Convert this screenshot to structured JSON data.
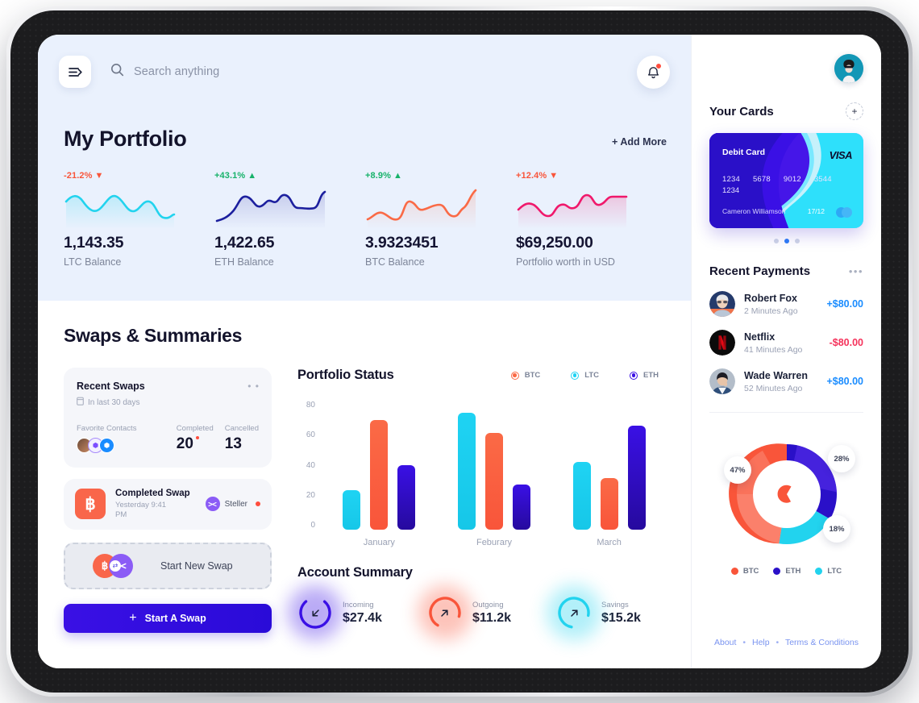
{
  "topbar": {
    "menu_icon": "menu-arrow-icon",
    "search_icon": "search-icon",
    "search_placeholder": "Search anything",
    "search_value": "",
    "bell_icon": "bell-icon",
    "avatar_icon": "user-avatar"
  },
  "portfolio": {
    "title": "My Portfolio",
    "add_more": "+ Add More",
    "stats": [
      {
        "delta": "-21.2%",
        "direction": "down",
        "value": "1,143.35",
        "label": "LTC Balance",
        "color": "#22d3ee"
      },
      {
        "delta": "+43.1%",
        "direction": "up",
        "value": "1,422.65",
        "label": "ETH Balance",
        "color": "#1c1f9e"
      },
      {
        "delta": "+8.9%",
        "direction": "up",
        "value": "3.9323451",
        "label": "BTC Balance",
        "color": "#fa6a46"
      },
      {
        "delta": "+12.4%",
        "direction": "down",
        "value": "$69,250.00",
        "label": "Portfolio worth in USD",
        "color": "#f0186b"
      }
    ]
  },
  "swaps": {
    "title": "Swaps & Summaries",
    "recent_swaps": {
      "title": "Recent Swaps",
      "calendar_icon": "calendar-icon",
      "subtitle": "In last 30 days",
      "more_icon": "more-dots-icon",
      "contacts_label": "Favorite Contacts",
      "completed_label": "Completed",
      "completed_value": "20",
      "cancelled_label": "Cancelled",
      "cancelled_value": "13"
    },
    "completed_swap": {
      "coin_icon": "bitcoin-icon",
      "title": "Completed Swap",
      "time": "Yesterday 9:41 PM",
      "partner_icon": "steller-icon",
      "partner": "Steller"
    },
    "start_new_swap": {
      "label": "Start New Swap",
      "from_icon": "bitcoin-icon",
      "to_icon": "steller-icon"
    },
    "start_a_swap_button": "Start A Swap",
    "plus_icon": "plus-icon"
  },
  "chart_data": {
    "type": "bar",
    "title": "Portfolio Status",
    "categories": [
      "January",
      "Feburary",
      "March"
    ],
    "series": [
      {
        "name": "LTC",
        "color": "#1fd3f3",
        "values": [
          27,
          80,
          46
        ]
      },
      {
        "name": "BTC",
        "color": "#fa6a46",
        "values": [
          75,
          66,
          35
        ]
      },
      {
        "name": "ETH",
        "color": "#3a10e5",
        "values": [
          44,
          31,
          71
        ]
      }
    ],
    "legend": [
      "BTC",
      "LTC",
      "ETH"
    ],
    "legend_colors": [
      "#fa6a46",
      "#1fd3f3",
      "#3a10e5"
    ],
    "legend_position": "top-right",
    "yticks": [
      "80",
      "60",
      "40",
      "20",
      "0"
    ],
    "ylim": [
      0,
      88
    ],
    "xlabel": "",
    "ylabel": "",
    "grid": false
  },
  "donut_data": {
    "type": "pie",
    "labels": [
      "BTC",
      "ETH",
      "LTC"
    ],
    "values": [
      47,
      28,
      18
    ],
    "display": [
      "47%",
      "28%",
      "18%"
    ],
    "colors": [
      "#fa6a46",
      "#2a10c8",
      "#22d3ee"
    ],
    "legend_position": "bottom"
  },
  "account_summary": {
    "title": "Account Summary",
    "items": [
      {
        "icon": "arrow-down-left-icon",
        "label": "Incoming",
        "value": "$27.4k",
        "color": "#3a10e5"
      },
      {
        "icon": "arrow-up-right-icon",
        "label": "Outgoing",
        "value": "$11.2k",
        "color": "#f9553a"
      },
      {
        "icon": "arrow-up-right-icon",
        "label": "Savings",
        "value": "$15.2k",
        "color": "#22d3ee"
      }
    ]
  },
  "sidebar": {
    "cards": {
      "title": "Your Cards",
      "add_icon": "add-card-icon",
      "card": {
        "type": "Debit Card",
        "brand": "VISA",
        "number_groups": [
          "1234",
          "5678",
          "9012",
          "3544"
        ],
        "number_overflow": "1234",
        "holder": "Cameron Williamson",
        "expiry": "17/12",
        "chip_icon": "mastercard-icon"
      },
      "pagination": {
        "count": 3,
        "active": 1
      }
    },
    "payments": {
      "title": "Recent Payments",
      "more_icon": "more-dots-icon",
      "items": [
        {
          "name": "Robert Fox",
          "time": "2 Minutes Ago",
          "amount": "+$80.00",
          "color": "#1a8cff",
          "avatar": "robert-fox-avatar"
        },
        {
          "name": "Netflix",
          "time": "41 Minutes Ago",
          "amount": "-$80.00",
          "color": "#f5325b",
          "avatar": "netflix-logo"
        },
        {
          "name": "Wade Warren",
          "time": "52 Minutes Ago",
          "amount": "+$80.00",
          "color": "#1a8cff",
          "avatar": "wade-warren-avatar"
        }
      ]
    },
    "footer": {
      "about": "About",
      "help": "Help",
      "terms": "Terms & Conditions"
    }
  }
}
